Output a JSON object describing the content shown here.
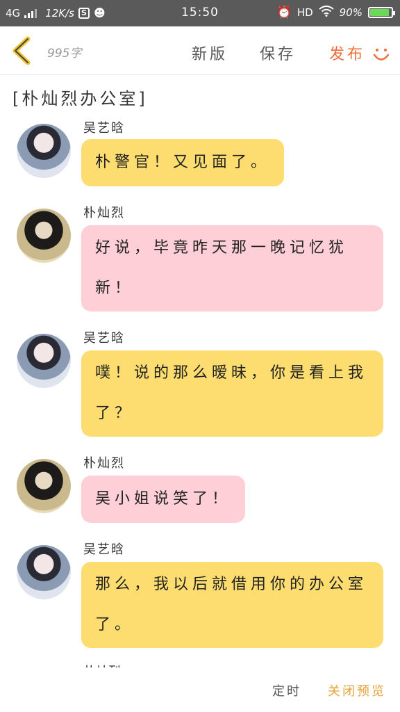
{
  "status_bar": {
    "network": "4G",
    "speed": "12K/s",
    "time": "15:50",
    "hd": "HD",
    "battery": "90%",
    "battery_level": 0.9
  },
  "toolbar": {
    "word_count": "995字",
    "new_label": "新版",
    "save_label": "保存",
    "publish_label": "发布"
  },
  "scene_title": "[朴灿烈办公室]",
  "messages": [
    {
      "sender": "吴艺晗",
      "text": "朴警官！又见面了。",
      "color": "yellow"
    },
    {
      "sender": "朴灿烈",
      "text": "好说，毕竟昨天那一晚记忆犹新！",
      "color": "pink"
    },
    {
      "sender": "吴艺晗",
      "text": "噗！说的那么暧昧，你是看上我了？",
      "color": "yellow"
    },
    {
      "sender": "朴灿烈",
      "text": "吴小姐说笑了！",
      "color": "pink"
    },
    {
      "sender": "吴艺晗",
      "text": "那么，我以后就借用你的办公室了。",
      "color": "yellow"
    }
  ],
  "next_sender_partial": "朴灿烈",
  "bottom_bar": {
    "timer_label": "定时",
    "close_preview_label": "关闭预览"
  },
  "colors": {
    "status_bar": "#5a5a5a",
    "bubble_yellow": "#fddd70",
    "bubble_pink": "#fecfd7",
    "publish_accent": "#ef6d3b",
    "close_preview_accent": "#e8a23a"
  }
}
